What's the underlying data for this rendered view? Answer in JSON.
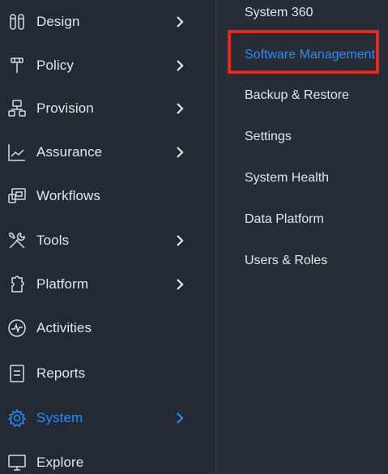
{
  "nav": {
    "items": [
      {
        "label": "Design",
        "icon": "design-icon",
        "has_submenu": true
      },
      {
        "label": "Policy",
        "icon": "policy-icon",
        "has_submenu": true
      },
      {
        "label": "Provision",
        "icon": "provision-icon",
        "has_submenu": true
      },
      {
        "label": "Assurance",
        "icon": "assurance-icon",
        "has_submenu": true
      },
      {
        "label": "Workflows",
        "icon": "workflows-icon",
        "has_submenu": false
      },
      {
        "label": "Tools",
        "icon": "tools-icon",
        "has_submenu": true
      },
      {
        "label": "Platform",
        "icon": "platform-icon",
        "has_submenu": true
      },
      {
        "label": "Activities",
        "icon": "activities-icon",
        "has_submenu": false
      },
      {
        "label": "Reports",
        "icon": "reports-icon",
        "has_submenu": false
      },
      {
        "label": "System",
        "icon": "gear-icon",
        "has_submenu": true,
        "active": true
      },
      {
        "label": "Explore",
        "icon": "explore-icon",
        "has_submenu": false
      }
    ]
  },
  "submenu": {
    "items": [
      {
        "label": "System 360"
      },
      {
        "label": "Software Management",
        "selected": true
      },
      {
        "label": "Backup & Restore"
      },
      {
        "label": "Settings"
      },
      {
        "label": "System Health"
      },
      {
        "label": "Data Platform"
      },
      {
        "label": "Users & Roles"
      }
    ]
  },
  "colors": {
    "background": "#232a33",
    "text": "#e4e7ea",
    "active": "#1e90ff",
    "highlight": "#e8281c"
  }
}
